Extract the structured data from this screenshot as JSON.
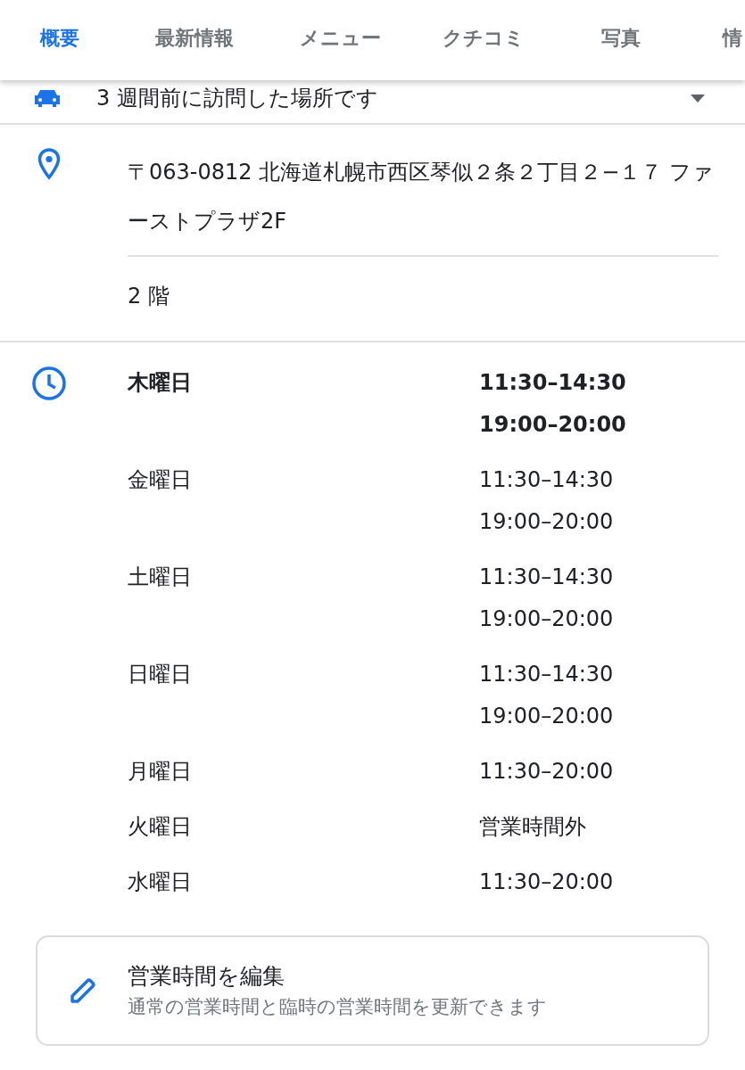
{
  "tabs": [
    {
      "label": "概要",
      "selected": true
    },
    {
      "label": "最新情報",
      "selected": false
    },
    {
      "label": "メニュー",
      "selected": false
    },
    {
      "label": "クチコミ",
      "selected": false
    },
    {
      "label": "写真",
      "selected": false
    },
    {
      "label": "情",
      "selected": false
    }
  ],
  "visited_note": "3 週間前に訪問した場所です",
  "address": {
    "text": "〒063-0812 北海道札幌市西区琴似２条２丁目２−１７ ファーストプラザ2F",
    "floor": "2 階"
  },
  "hours": [
    {
      "day": "木曜日",
      "times": [
        "11:30–14:30",
        "19:00–20:00"
      ],
      "today": true
    },
    {
      "day": "金曜日",
      "times": [
        "11:30–14:30",
        "19:00–20:00"
      ],
      "today": false
    },
    {
      "day": "土曜日",
      "times": [
        "11:30–14:30",
        "19:00–20:00"
      ],
      "today": false
    },
    {
      "day": "日曜日",
      "times": [
        "11:30–14:30",
        "19:00–20:00"
      ],
      "today": false
    },
    {
      "day": "月曜日",
      "times": [
        "11:30–20:00"
      ],
      "today": false
    },
    {
      "day": "火曜日",
      "times": [
        "営業時間外"
      ],
      "today": false
    },
    {
      "day": "水曜日",
      "times": [
        "11:30–20:00"
      ],
      "today": false
    }
  ],
  "edit_hours": {
    "title": "営業時間を編集",
    "subtitle": "通常の営業時間と臨時の営業時間を更新できます"
  }
}
